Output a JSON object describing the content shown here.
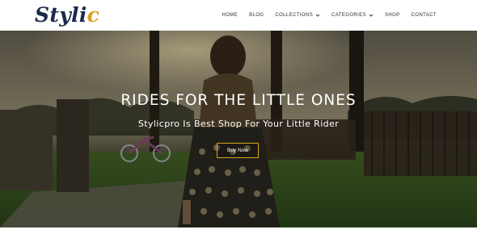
{
  "brand": {
    "logo_text_main": "Styli",
    "logo_text_accent": "c"
  },
  "nav": {
    "items": [
      {
        "label": "HOME",
        "has_dropdown": false
      },
      {
        "label": "BLOG",
        "has_dropdown": false
      },
      {
        "label": "COLLECTIONS",
        "has_dropdown": true
      },
      {
        "label": "CATEGORIES",
        "has_dropdown": true
      },
      {
        "label": "SHOP",
        "has_dropdown": false
      },
      {
        "label": "CONTACT",
        "has_dropdown": false
      }
    ]
  },
  "hero": {
    "title": "RIDES FOR THE LITTLE ONES",
    "subtitle": "Stylicpro Is Best Shop For Your Little Rider",
    "cta_label": "Buy Now"
  },
  "colors": {
    "accent": "#d9a21b",
    "logo": "#1b2a4a",
    "nav_text": "#2c2c2c"
  }
}
